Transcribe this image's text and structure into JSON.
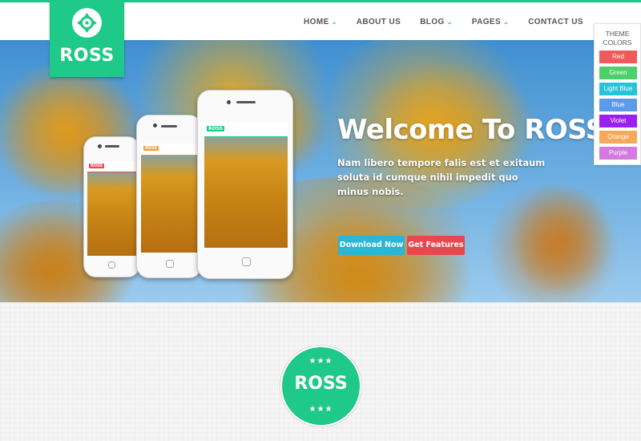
{
  "brand": {
    "name": "ROSS",
    "accent": "#1fc98a"
  },
  "nav": {
    "items": [
      {
        "label": "HOME",
        "dropdown": true
      },
      {
        "label": "ABOUT US",
        "dropdown": false
      },
      {
        "label": "BLOG",
        "dropdown": true
      },
      {
        "label": "PAGES",
        "dropdown": true
      },
      {
        "label": "CONTACT US",
        "dropdown": false
      }
    ]
  },
  "hero": {
    "title": "Welcome To ROSS",
    "subtitle": "Nam libero tempore falis est et exitaum soluta id cumque nihil impedit quo minus nobis.",
    "download_button": "Download Now",
    "features_button": "Get Features",
    "download_color": "#2ab6d8",
    "features_color": "#e9474f"
  },
  "phones": [
    {
      "badge": "ROSS",
      "badge_color": "#e9474f"
    },
    {
      "badge": "ROSS",
      "badge_color": "#f29c38"
    },
    {
      "badge": "ROSS",
      "badge_color": "#1fc98a"
    }
  ],
  "theme_panel": {
    "title_line1": "THEME",
    "title_line2": "COLORS",
    "swatches": [
      {
        "label": "Red",
        "color": "#f05a5a"
      },
      {
        "label": "Green",
        "color": "#4dd06a"
      },
      {
        "label": "Light Blue",
        "color": "#27c4d9"
      },
      {
        "label": "Blue",
        "color": "#5b9be8"
      },
      {
        "label": "Violet",
        "color": "#9b1ff2"
      },
      {
        "label": "Orange",
        "color": "#f7a85a"
      },
      {
        "label": "Purple",
        "color": "#d27be0"
      }
    ]
  },
  "section_logo": {
    "name": "ROSS",
    "stars_top": "★★★",
    "stars_bottom": "★★★"
  }
}
